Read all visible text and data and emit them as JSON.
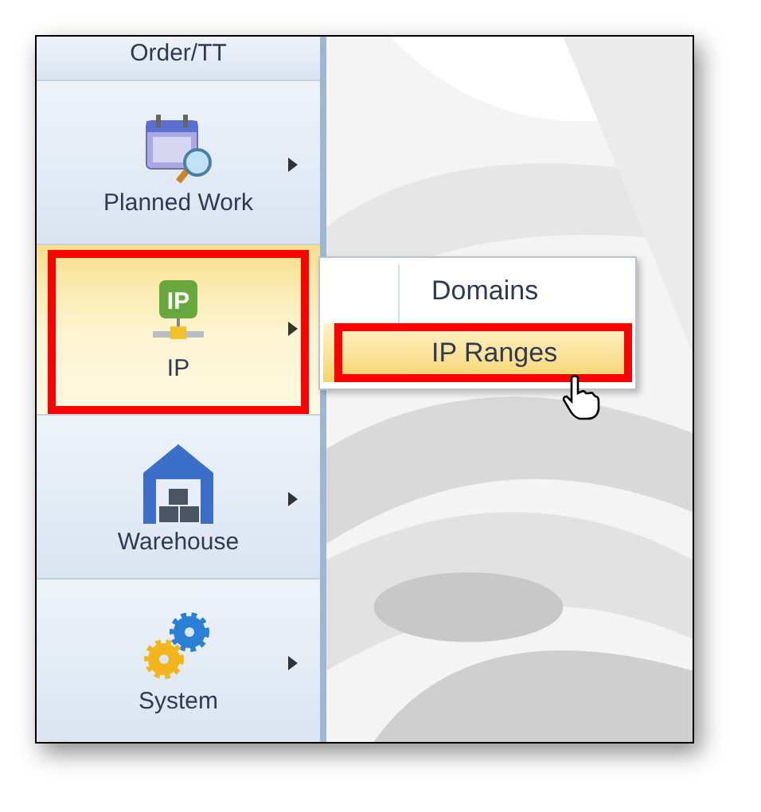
{
  "sidebar": {
    "items": [
      {
        "label": "Order/TT",
        "selected": false,
        "annotated": false
      },
      {
        "label": "Planned Work",
        "selected": false,
        "annotated": false
      },
      {
        "label": "IP",
        "badge": "IP",
        "selected": true,
        "annotated": true
      },
      {
        "label": "Warehouse",
        "selected": false,
        "annotated": false
      },
      {
        "label": "System",
        "selected": false,
        "annotated": false
      }
    ]
  },
  "submenu": {
    "items": [
      {
        "label": "Domains",
        "selected": false,
        "annotated": false
      },
      {
        "label": "IP Ranges",
        "selected": true,
        "annotated": true
      }
    ]
  }
}
